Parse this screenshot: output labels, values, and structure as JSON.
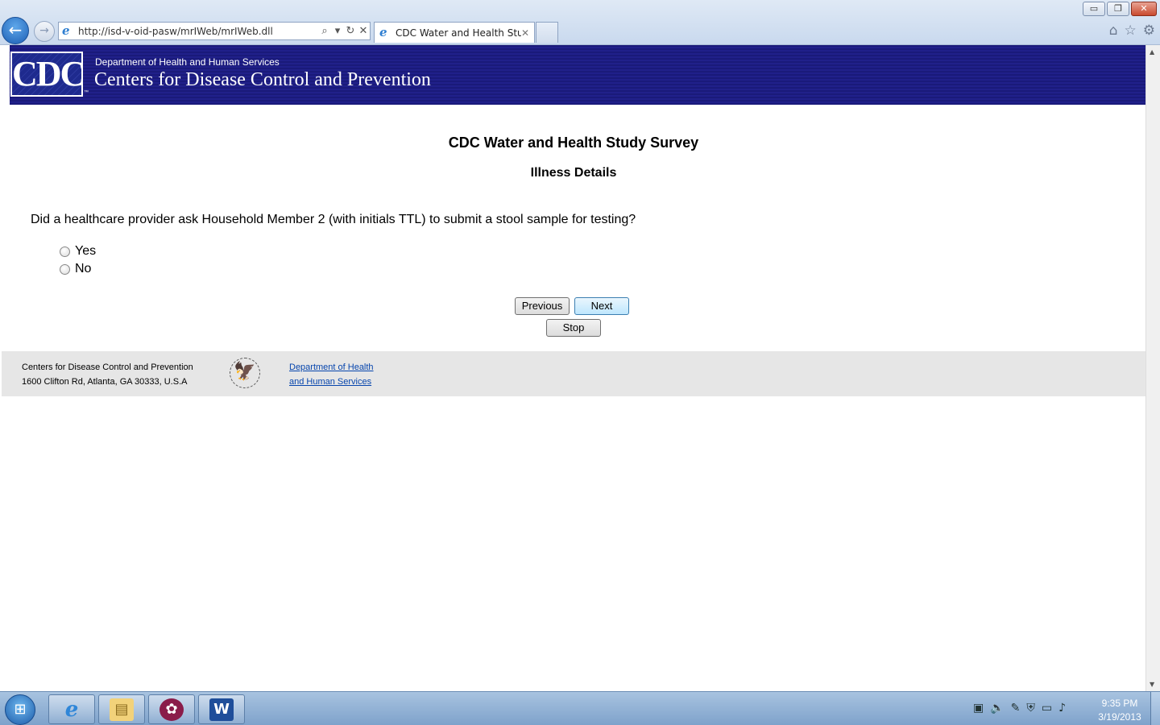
{
  "browser": {
    "url": "http://isd-v-oid-pasw/mrIWeb/mrIWeb.dll",
    "tab_title": "CDC Water and Health Study",
    "window_buttons": [
      "▭",
      "❐",
      "✕"
    ]
  },
  "banner": {
    "logo_text": "CDC",
    "department": "Department of Health and Human Services",
    "agency": "Centers for Disease Control and Prevention"
  },
  "survey": {
    "title": "CDC Water and Health Study Survey",
    "section": "Illness Details",
    "question": "Did a healthcare provider ask Household Member 2 (with initials TTL) to submit a stool sample for testing?",
    "options": [
      {
        "label": "Yes",
        "selected": false
      },
      {
        "label": "No",
        "selected": false
      }
    ],
    "buttons": {
      "previous": "Previous",
      "next": "Next",
      "stop": "Stop"
    }
  },
  "footer": {
    "org_name": "Centers for Disease Control and Prevention",
    "address": "1600 Clifton Rd, Atlanta, GA 30333, U.S.A",
    "link_line1": "Department of Health",
    "link_line2": "and Human Services"
  },
  "taskbar": {
    "time": "9:35 PM",
    "date": "3/19/2013"
  },
  "colors": {
    "banner_blue": "#1a1a7a",
    "footer_gray": "#e6e6e6",
    "link_blue": "#0645ad",
    "next_button": "#bee6fd"
  }
}
